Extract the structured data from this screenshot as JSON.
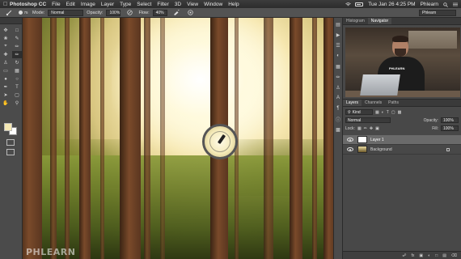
{
  "menubar": {
    "app_name": "Photoshop CC",
    "items": [
      "File",
      "Edit",
      "Image",
      "Layer",
      "Type",
      "Select",
      "Filter",
      "3D",
      "View",
      "Window",
      "Help"
    ],
    "clock": "Tue Jan 26  4:25 PM",
    "user": "Phlearn"
  },
  "options": {
    "brush_size": "75",
    "mode_label": "Mode:",
    "mode_value": "Normal",
    "opacity_label": "Opacity:",
    "opacity_value": "100%",
    "flow_label": "Flow:",
    "flow_value": "40%",
    "workspace": "Phlearn"
  },
  "panels": {
    "top_tabs": [
      "Histogram",
      "Navigator"
    ],
    "video_shirt_text": "PHLEARN",
    "layers_tabs": [
      "Layers",
      "Channels",
      "Paths"
    ],
    "kind_label": "Kind",
    "blend_mode": "Normal",
    "opacity_label": "Opacity:",
    "opacity_value": "100%",
    "lock_label": "Lock:",
    "fill_label": "Fill:",
    "fill_value": "100%",
    "layers": [
      "Layer 1",
      "Background"
    ]
  },
  "canvas": {
    "watermark": "PHLEARN"
  }
}
